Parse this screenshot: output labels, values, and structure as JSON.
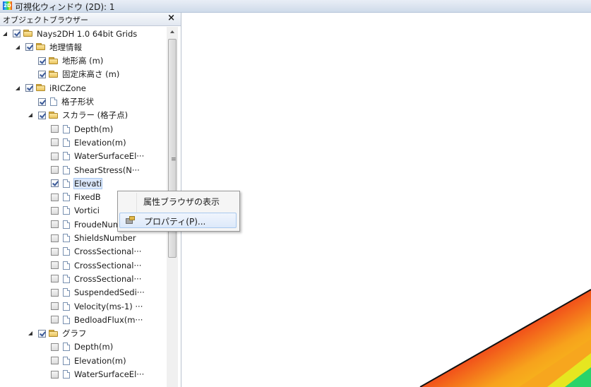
{
  "window": {
    "title": "可視化ウィンドウ (2D): 1",
    "icon_label": "2D",
    "icon": "visualization-2d-icon"
  },
  "panel": {
    "title": "オブジェクトブラウザー",
    "close_label": "×"
  },
  "tree": [
    {
      "label": "Nays2DH 1.0 64bit Grids",
      "level": 0,
      "expander": true,
      "checked": true,
      "icon": "folder"
    },
    {
      "label": "地理情報",
      "level": 1,
      "expander": true,
      "checked": true,
      "icon": "folder"
    },
    {
      "label": "地形高 (m)",
      "level": 2,
      "expander": false,
      "checked": true,
      "icon": "folder"
    },
    {
      "label": "固定床高さ (m)",
      "level": 2,
      "expander": false,
      "checked": true,
      "icon": "folder"
    },
    {
      "label": "iRICZone",
      "level": 1,
      "expander": true,
      "checked": true,
      "icon": "folder"
    },
    {
      "label": "格子形状",
      "level": 2,
      "expander": false,
      "checked": true,
      "icon": "doc"
    },
    {
      "label": "スカラー (格子点)",
      "level": 2,
      "expander": true,
      "checked": true,
      "icon": "folder"
    },
    {
      "label": "Depth(m)",
      "level": 3,
      "expander": false,
      "checked": false,
      "icon": "doc"
    },
    {
      "label": "Elevation(m)",
      "level": 3,
      "expander": false,
      "checked": false,
      "icon": "doc"
    },
    {
      "label": "WaterSurfaceEl···",
      "level": 3,
      "expander": false,
      "checked": false,
      "icon": "doc"
    },
    {
      "label": "ShearStress(N···",
      "level": 3,
      "expander": false,
      "checked": false,
      "icon": "doc"
    },
    {
      "label": "Elevati",
      "level": 3,
      "expander": false,
      "checked": true,
      "icon": "doc",
      "selected": true
    },
    {
      "label": "FixedB",
      "level": 3,
      "expander": false,
      "checked": false,
      "icon": "doc"
    },
    {
      "label": "Vortici",
      "level": 3,
      "expander": false,
      "checked": false,
      "icon": "doc"
    },
    {
      "label": "FroudeNumber",
      "level": 3,
      "expander": false,
      "checked": false,
      "icon": "doc"
    },
    {
      "label": "ShieldsNumber",
      "level": 3,
      "expander": false,
      "checked": false,
      "icon": "doc"
    },
    {
      "label": "CrossSectional···",
      "level": 3,
      "expander": false,
      "checked": false,
      "icon": "doc"
    },
    {
      "label": "CrossSectional···",
      "level": 3,
      "expander": false,
      "checked": false,
      "icon": "doc"
    },
    {
      "label": "CrossSectional···",
      "level": 3,
      "expander": false,
      "checked": false,
      "icon": "doc"
    },
    {
      "label": "SuspendedSedi···",
      "level": 3,
      "expander": false,
      "checked": false,
      "icon": "doc"
    },
    {
      "label": "Velocity(ms-1) ···",
      "level": 3,
      "expander": false,
      "checked": false,
      "icon": "doc"
    },
    {
      "label": "BedloadFlux(m···",
      "level": 3,
      "expander": false,
      "checked": false,
      "icon": "doc"
    },
    {
      "label": "グラフ",
      "level": 2,
      "expander": true,
      "checked": true,
      "icon": "folder"
    },
    {
      "label": "Depth(m)",
      "level": 3,
      "expander": false,
      "checked": false,
      "icon": "doc"
    },
    {
      "label": "Elevation(m)",
      "level": 3,
      "expander": false,
      "checked": false,
      "icon": "doc"
    },
    {
      "label": "WaterSurfaceEl···",
      "level": 3,
      "expander": false,
      "checked": false,
      "icon": "doc"
    }
  ],
  "context_menu": {
    "show_attribute_browser": "属性ブラウザの表示",
    "properties": "プロパティ(P)...",
    "properties_icon": "properties-icon"
  },
  "colors": {
    "contour_high": "#e8141b",
    "contour_mid": "#f7d21c",
    "contour_low": "#2bd36a"
  }
}
